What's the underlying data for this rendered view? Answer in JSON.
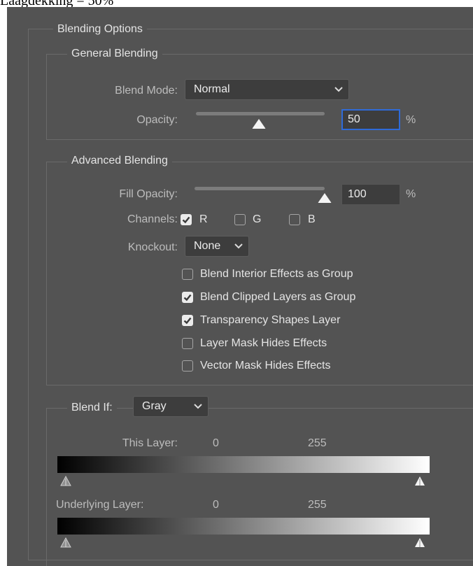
{
  "caption": "Laagdekking = 50%",
  "blending_options": {
    "title": "Blending Options"
  },
  "general": {
    "title": "General Blending",
    "blend_mode_label": "Blend Mode:",
    "blend_mode_value": "Normal",
    "opacity_label": "Opacity:",
    "opacity_value": "50",
    "opacity_unit": "%",
    "opacity_level": 0.5
  },
  "advanced": {
    "title": "Advanced Blending",
    "fill_opacity_label": "Fill Opacity:",
    "fill_opacity_value": "100",
    "fill_opacity_unit": "%",
    "fill_opacity_level": 1.0,
    "channels_label": "Channels:",
    "channels": [
      {
        "label": "R",
        "checked": true
      },
      {
        "label": "G",
        "checked": false
      },
      {
        "label": "B",
        "checked": false
      }
    ],
    "knockout_label": "Knockout:",
    "knockout_value": "None",
    "options": [
      {
        "label": "Blend Interior Effects as Group",
        "checked": false
      },
      {
        "label": "Blend Clipped Layers as Group",
        "checked": true
      },
      {
        "label": "Transparency Shapes Layer",
        "checked": true
      },
      {
        "label": "Layer Mask Hides Effects",
        "checked": false
      },
      {
        "label": "Vector Mask Hides Effects",
        "checked": false
      }
    ]
  },
  "blend_if": {
    "label": "Blend If:",
    "value": "Gray",
    "this_layer": {
      "label": "This Layer:",
      "low": "0",
      "high": "255"
    },
    "underlying_layer": {
      "label": "Underlying Layer:",
      "low": "0",
      "high": "255"
    }
  },
  "colors": {
    "panel": "#535353",
    "accent": "#2f6bd8"
  }
}
